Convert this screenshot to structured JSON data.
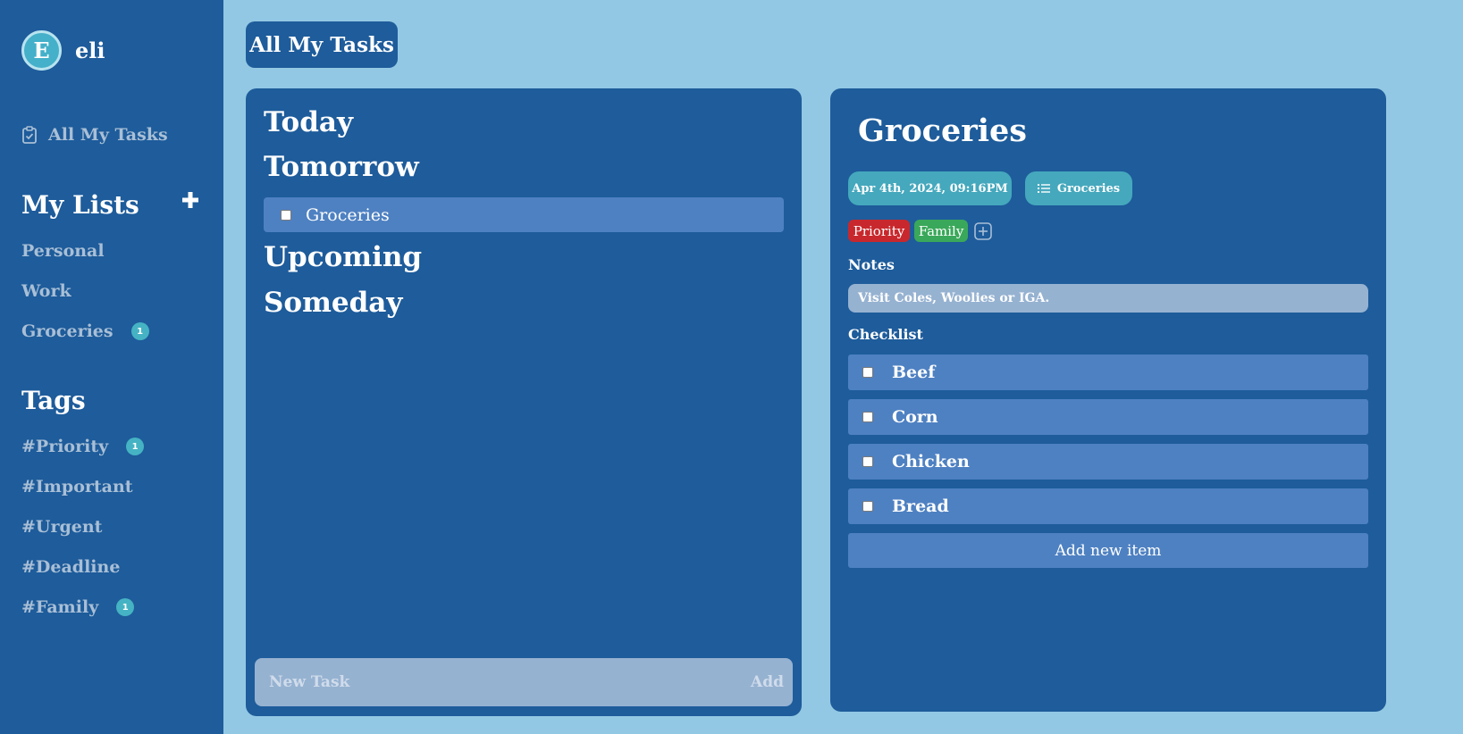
{
  "user": {
    "initial": "E",
    "name": "eli"
  },
  "nav": {
    "all_tasks": "All My Tasks"
  },
  "lists": {
    "title": "My Lists",
    "items": [
      {
        "label": "Personal",
        "count": ""
      },
      {
        "label": "Work",
        "count": ""
      },
      {
        "label": "Groceries",
        "count": "1"
      }
    ]
  },
  "tags": {
    "title": "Tags",
    "items": [
      {
        "label": "#Priority",
        "count": "1"
      },
      {
        "label": "#Important",
        "count": ""
      },
      {
        "label": "#Urgent",
        "count": ""
      },
      {
        "label": "#Deadline",
        "count": ""
      },
      {
        "label": "#Family",
        "count": "1"
      }
    ]
  },
  "header": {
    "title": "All My Tasks"
  },
  "task_panel": {
    "groups": [
      "Today",
      "Tomorrow",
      "Upcoming",
      "Someday"
    ],
    "tasks": [
      {
        "group": "Tomorrow",
        "label": "Groceries"
      }
    ],
    "new_task_placeholder": "New Task",
    "add_label": "Add"
  },
  "detail": {
    "title": "Groceries",
    "date": "Apr 4th, 2024, 09:16PM",
    "list_name": "Groceries",
    "tags": [
      {
        "label": "Priority",
        "color": "#c8282d"
      },
      {
        "label": "Family",
        "color": "#3aa85a"
      }
    ],
    "notes_label": "Notes",
    "notes": "Visit Coles, Woolies or IGA.",
    "checklist_label": "Checklist",
    "checklist": [
      "Beef",
      "Corn",
      "Chicken",
      "Bread"
    ],
    "add_item_label": "Add new item"
  },
  "colors": {
    "background": "#93c8e4",
    "panel": "#1e5c9b",
    "row": "#4e81c2",
    "accent": "#45a8bd",
    "muted_text": "#a9bfd6"
  }
}
